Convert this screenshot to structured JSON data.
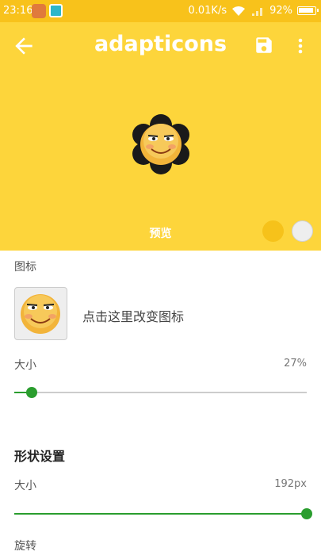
{
  "status_bar": {
    "time": "23:16",
    "network_speed": "0.01K/s",
    "battery": "92%"
  },
  "app_bar": {
    "title": "adapticons"
  },
  "preview": {
    "label": "预览",
    "colors": [
      "#f6c21a",
      "#eeeeee"
    ]
  },
  "icon_section": {
    "label": "图标",
    "change_text": "点击这里改变图标"
  },
  "icon_size": {
    "label": "大小",
    "value": "27%",
    "fraction": 0.06
  },
  "shape_settings": {
    "heading": "形状设置",
    "size_label": "大小",
    "size_value": "192px",
    "size_fraction": 1.0,
    "rotation_label": "旋转"
  },
  "colors": {
    "header": "#fdd53b",
    "accent": "#2a9d2e"
  }
}
